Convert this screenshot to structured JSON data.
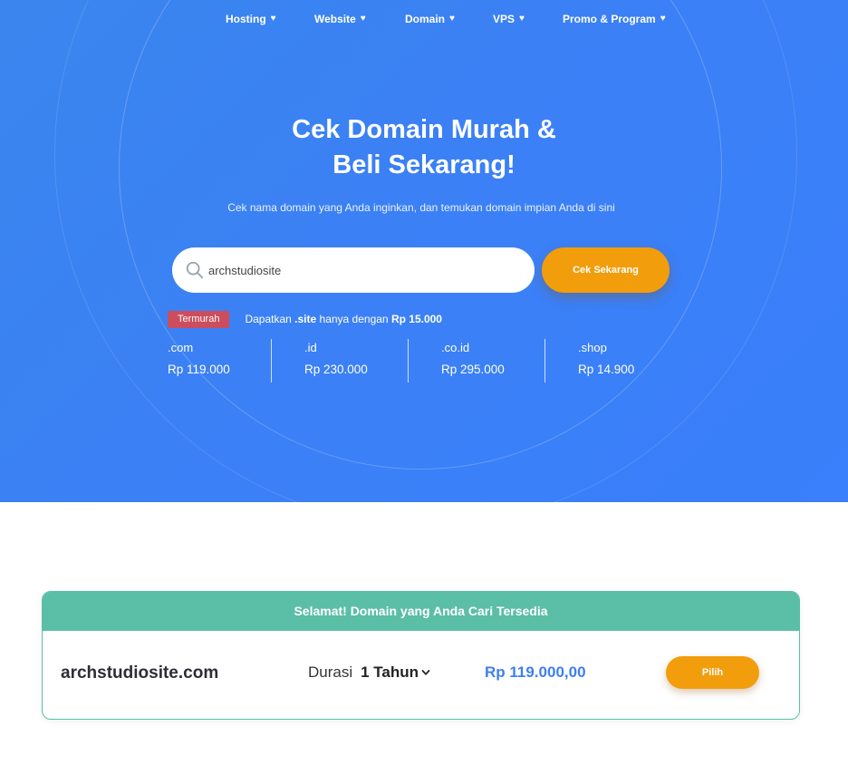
{
  "nav": {
    "items": [
      {
        "label": "Hosting"
      },
      {
        "label": "Website"
      },
      {
        "label": "Domain"
      },
      {
        "label": "VPS"
      },
      {
        "label": "Promo & Program"
      }
    ]
  },
  "hero": {
    "title_line1": "Cek Domain Murah &",
    "title_line2": "Beli Sekarang!",
    "subtitle": "Cek nama domain yang Anda inginkan, dan temukan domain impian Anda di sini"
  },
  "search": {
    "value": "archstudiosite",
    "button_label": "Cek Sekarang"
  },
  "promo": {
    "badge": "Termurah",
    "text_prefix": "Dapatkan ",
    "tld": ".site",
    "text_mid": " hanya dengan ",
    "price": "Rp 15.000"
  },
  "prices": [
    {
      "tld": ".com",
      "price": "Rp 119.000"
    },
    {
      "tld": ".id",
      "price": "Rp 230.000"
    },
    {
      "tld": ".co.id",
      "price": "Rp 295.000"
    },
    {
      "tld": ".shop",
      "price": "Rp 14.900"
    }
  ],
  "result": {
    "header": "Selamat! Domain yang Anda Cari Tersedia",
    "domain": "archstudiosite.com",
    "duration_label": "Durasi",
    "duration_value": "1 Tahun",
    "price": "Rp 119.000,00",
    "select_label": "Pilih"
  },
  "colors": {
    "hero_blue": "#3a80f5",
    "accent_orange": "#f29d0b",
    "badge_red": "#cc4d5c",
    "result_green": "#5bbea6",
    "price_blue": "#3d7ff0"
  },
  "icons": [
    "heart-icon",
    "search-icon",
    "chevron-down-icon"
  ]
}
